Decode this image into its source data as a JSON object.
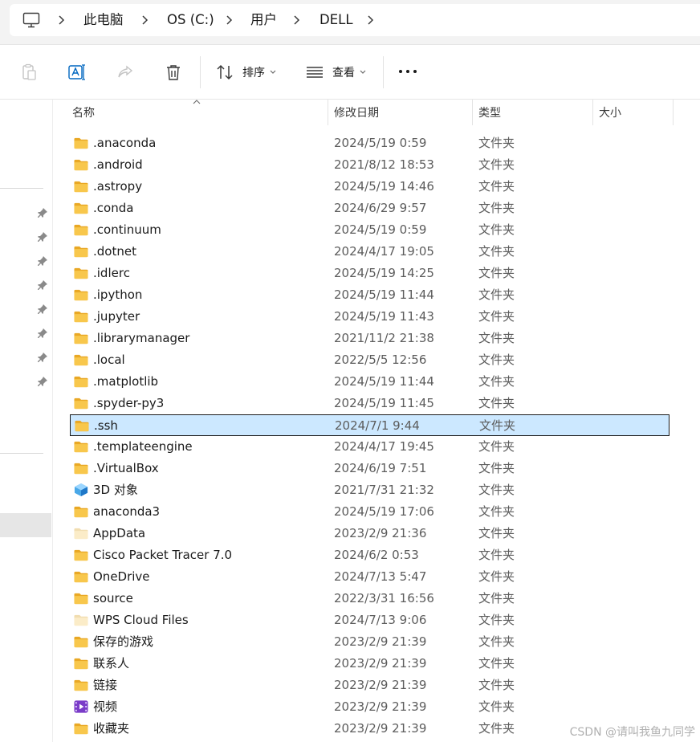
{
  "address_bar": {
    "crumbs": [
      "此电脑",
      "OS (C:)",
      "用户",
      "DELL"
    ]
  },
  "toolbar": {
    "sort_label": "排序",
    "view_label": "查看"
  },
  "columns": {
    "name": "名称",
    "date": "修改日期",
    "type": "类型",
    "size": "大小"
  },
  "files": [
    {
      "name": ".anaconda",
      "date": "2024/5/19 0:59",
      "type": "文件夹",
      "icon": "folder-icon"
    },
    {
      "name": ".android",
      "date": "2021/8/12 18:53",
      "type": "文件夹",
      "icon": "folder-icon"
    },
    {
      "name": ".astropy",
      "date": "2024/5/19 14:46",
      "type": "文件夹",
      "icon": "folder-icon"
    },
    {
      "name": ".conda",
      "date": "2024/6/29 9:57",
      "type": "文件夹",
      "icon": "folder-icon"
    },
    {
      "name": ".continuum",
      "date": "2024/5/19 0:59",
      "type": "文件夹",
      "icon": "folder-icon"
    },
    {
      "name": ".dotnet",
      "date": "2024/4/17 19:05",
      "type": "文件夹",
      "icon": "folder-icon"
    },
    {
      "name": ".idlerc",
      "date": "2024/5/19 14:25",
      "type": "文件夹",
      "icon": "folder-icon"
    },
    {
      "name": ".ipython",
      "date": "2024/5/19 11:44",
      "type": "文件夹",
      "icon": "folder-icon"
    },
    {
      "name": ".jupyter",
      "date": "2024/5/19 11:43",
      "type": "文件夹",
      "icon": "folder-icon"
    },
    {
      "name": ".librarymanager",
      "date": "2021/11/2 21:38",
      "type": "文件夹",
      "icon": "folder-icon"
    },
    {
      "name": ".local",
      "date": "2022/5/5 12:56",
      "type": "文件夹",
      "icon": "folder-icon"
    },
    {
      "name": ".matplotlib",
      "date": "2024/5/19 11:44",
      "type": "文件夹",
      "icon": "folder-icon"
    },
    {
      "name": ".spyder-py3",
      "date": "2024/5/19 11:45",
      "type": "文件夹",
      "icon": "folder-icon"
    },
    {
      "name": ".ssh",
      "date": "2024/7/1 9:44",
      "type": "文件夹",
      "icon": "folder-icon",
      "selected": true
    },
    {
      "name": ".templateengine",
      "date": "2024/4/17 19:45",
      "type": "文件夹",
      "icon": "folder-icon"
    },
    {
      "name": ".VirtualBox",
      "date": "2024/6/19 7:51",
      "type": "文件夹",
      "icon": "folder-icon"
    },
    {
      "name": "3D 对象",
      "date": "2021/7/31 21:32",
      "type": "文件夹",
      "icon": "3d-objects-icon"
    },
    {
      "name": "anaconda3",
      "date": "2024/5/19 17:06",
      "type": "文件夹",
      "icon": "folder-icon"
    },
    {
      "name": "AppData",
      "date": "2023/2/9 21:36",
      "type": "文件夹",
      "icon": "hidden-folder-icon"
    },
    {
      "name": "Cisco Packet Tracer 7.0",
      "date": "2024/6/2 0:53",
      "type": "文件夹",
      "icon": "folder-icon"
    },
    {
      "name": "OneDrive",
      "date": "2024/7/13 5:47",
      "type": "文件夹",
      "icon": "folder-icon"
    },
    {
      "name": "source",
      "date": "2022/3/31 16:56",
      "type": "文件夹",
      "icon": "folder-icon"
    },
    {
      "name": "WPS Cloud Files",
      "date": "2024/7/13 9:06",
      "type": "文件夹",
      "icon": "hidden-folder-icon"
    },
    {
      "name": "保存的游戏",
      "date": "2023/2/9 21:39",
      "type": "文件夹",
      "icon": "folder-icon"
    },
    {
      "name": "联系人",
      "date": "2023/2/9 21:39",
      "type": "文件夹",
      "icon": "folder-icon"
    },
    {
      "name": "链接",
      "date": "2023/2/9 21:39",
      "type": "文件夹",
      "icon": "folder-icon"
    },
    {
      "name": "视频",
      "date": "2023/2/9 21:39",
      "type": "文件夹",
      "icon": "videos-icon"
    },
    {
      "name": "收藏夹",
      "date": "2023/2/9 21:39",
      "type": "文件夹",
      "icon": "folder-icon"
    }
  ],
  "colors": {
    "accent": "#0067c0",
    "selection": "#cce8ff",
    "folder": "#f8c74c",
    "folder_dark": "#e9a825"
  },
  "watermark": "CSDN @请叫我鱼九同学"
}
